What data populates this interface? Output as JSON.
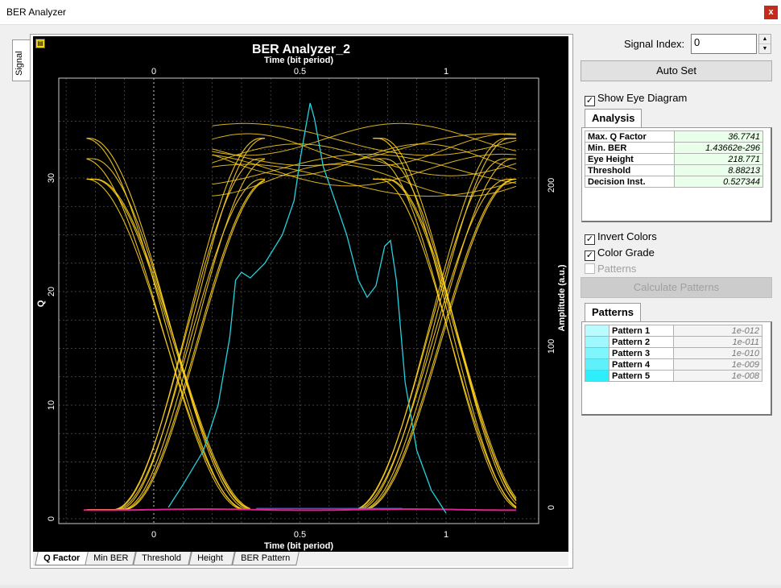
{
  "window": {
    "title": "BER Analyzer",
    "close_label": "x"
  },
  "side_tab": {
    "label": "Signal"
  },
  "plot": {
    "title": "BER Analyzer_2",
    "top_axis_label": "Time (bit period)",
    "bottom_axis_label": "Time (bit period)",
    "left_axis_label": "Q",
    "right_axis_label": "Amplitude (a.u.)",
    "x_ticks": [
      "0",
      "0.5",
      "1"
    ],
    "left_ticks": [
      "0",
      "10",
      "20",
      "30"
    ],
    "right_ticks": [
      "0",
      "100",
      "200"
    ],
    "colors": {
      "background": "#000000",
      "grid": "#555555",
      "eye": "#ffd21e",
      "q_curve": "#22d3e0",
      "baseline": "#e0208c"
    }
  },
  "bottom_tabs": [
    "Q Factor",
    "Min BER",
    "Threshold",
    "Height",
    "BER Pattern"
  ],
  "controls": {
    "signal_index_label": "Signal Index:",
    "signal_index_value": "0",
    "auto_set_label": "Auto Set",
    "show_eye_label": "Show Eye Diagram",
    "invert_colors_label": "Invert Colors",
    "color_grade_label": "Color Grade",
    "patterns_label": "Patterns",
    "calculate_patterns_label": "Calculate Patterns",
    "check_mark": "✓"
  },
  "analysis": {
    "tab_label": "Analysis",
    "rows": [
      {
        "key": "Max. Q Factor",
        "value": "36.7741"
      },
      {
        "key": "Min. BER",
        "value": "1.43662e-296"
      },
      {
        "key": "Eye Height",
        "value": "218.771"
      },
      {
        "key": "Threshold",
        "value": "8.88213"
      },
      {
        "key": "Decision Inst.",
        "value": "0.527344"
      }
    ]
  },
  "patterns": {
    "tab_label": "Patterns",
    "rows": [
      {
        "name": "Pattern 1",
        "value": "1e-012",
        "color": "#b9fbff"
      },
      {
        "name": "Pattern 2",
        "value": "1e-011",
        "color": "#9ff8ff"
      },
      {
        "name": "Pattern 3",
        "value": "1e-010",
        "color": "#7ff5fd"
      },
      {
        "name": "Pattern 4",
        "value": "1e-009",
        "color": "#5ff1fb"
      },
      {
        "name": "Pattern 5",
        "value": "1e-008",
        "color": "#2deefa"
      }
    ]
  }
}
